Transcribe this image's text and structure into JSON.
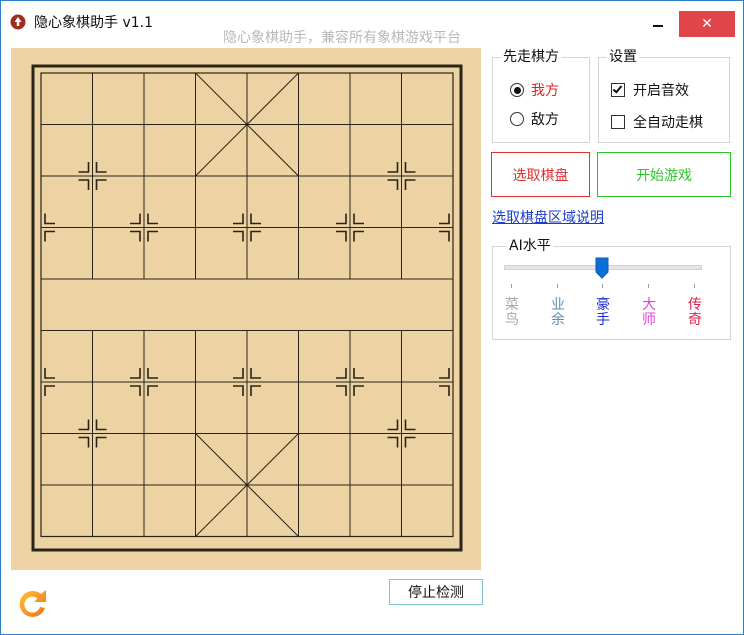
{
  "window": {
    "title": "隐心象棋助手 v1.1",
    "subtitle": "隐心象棋助手，兼容所有象棋游戏平台",
    "close_label": "✕"
  },
  "first_move": {
    "legend": "先走棋方",
    "options": [
      {
        "label": "我方",
        "selected": true,
        "color": "#e02020"
      },
      {
        "label": "敌方",
        "selected": false,
        "color": "#111111"
      }
    ]
  },
  "settings": {
    "legend": "设置",
    "options": [
      {
        "label": "开启音效",
        "checked": true
      },
      {
        "label": "全自动走棋",
        "checked": false
      }
    ]
  },
  "buttons": {
    "select_board": "选取棋盘",
    "start_game": "开始游戏",
    "stop_detect": "停止检测"
  },
  "help_link": "选取棋盘区域说明",
  "ai_level": {
    "legend": "AI水平",
    "selected_index": 2,
    "levels": [
      {
        "label": "菜鸟",
        "color": "#a9a9a9"
      },
      {
        "label": "业余",
        "color": "#5a8fb8"
      },
      {
        "label": "豪手",
        "color": "#1a2fd0"
      },
      {
        "label": "大师",
        "color": "#e040e0"
      },
      {
        "label": "传奇",
        "color": "#e0204a"
      }
    ]
  },
  "colors": {
    "board_bg": "#edd3a4",
    "board_line": "#2a2418",
    "accent": "#0b6fd8",
    "close_bg": "#e0454a"
  },
  "icons": {
    "app": "app-logo-icon",
    "refresh": "refresh-icon",
    "minimize": "minimize-icon",
    "close": "close-icon"
  }
}
